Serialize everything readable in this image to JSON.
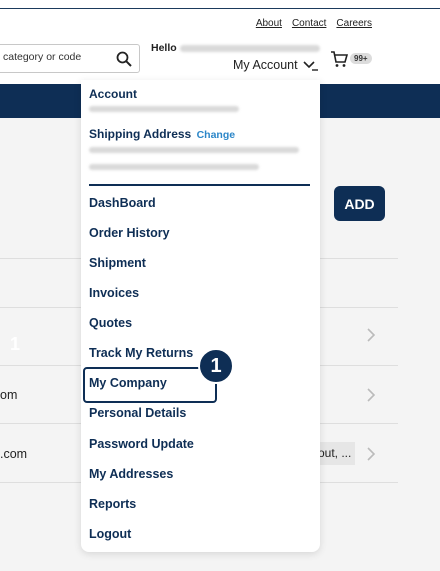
{
  "header": {
    "links": [
      "About",
      "Contact",
      "Careers"
    ],
    "search": {
      "placeholder": "category or code"
    },
    "greeting": "Hello",
    "account_label": "My Account",
    "cart_badge": "99+"
  },
  "content": {
    "add_label": "ADD",
    "rows": [
      "om",
      ".com"
    ],
    "chip": "out, ...",
    "ghost_number": "1"
  },
  "menu": {
    "account_heading": "Account",
    "shipping_heading": "Shipping Address",
    "change_label": "Change",
    "items": [
      "DashBoard",
      "Order History",
      "Shipment",
      "Invoices",
      "Quotes",
      "Track My Returns",
      "My Company",
      "Personal Details",
      "Password Update",
      "My Addresses",
      "Reports",
      "Logout"
    ],
    "highlighted_item": "My Company"
  },
  "annotation": {
    "step": "1"
  },
  "colors": {
    "brand_navy": "#0e2e55",
    "link_blue": "#2b86c8"
  }
}
